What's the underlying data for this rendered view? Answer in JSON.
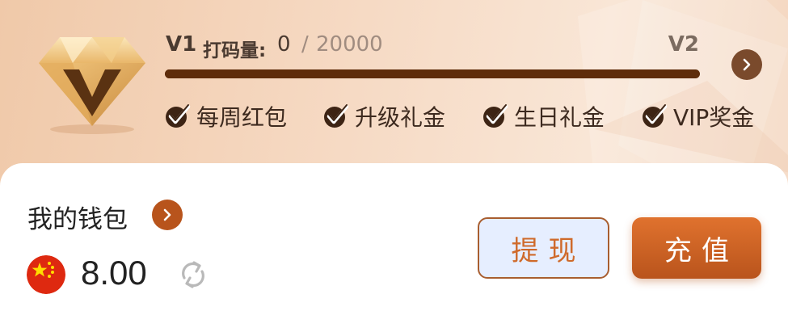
{
  "vip": {
    "current_level": "V1",
    "next_level": "V2",
    "bet_label": "打码量:",
    "bet_current": "0",
    "bet_separator": "/",
    "bet_target": "20000",
    "progress_fraction": 0,
    "badge_icon": "diamond-v-icon",
    "arrow_icon": "chevron-right-icon",
    "perks": [
      {
        "label": "每周红包",
        "icon": "check-badge-icon"
      },
      {
        "label": "升级礼金",
        "icon": "check-badge-icon"
      },
      {
        "label": "生日礼金",
        "icon": "check-badge-icon"
      },
      {
        "label": "VIP奖金",
        "icon": "check-badge-icon"
      }
    ]
  },
  "wallet": {
    "title": "我的钱包",
    "currency_icon": "china-flag-icon",
    "balance": "8.00",
    "refresh_icon": "refresh-icon",
    "withdraw_label": "提现",
    "deposit_label": "充值"
  },
  "colors": {
    "accent": "#b8541c",
    "progress": "#5e2c0a",
    "banner": "#f3d3bb"
  }
}
